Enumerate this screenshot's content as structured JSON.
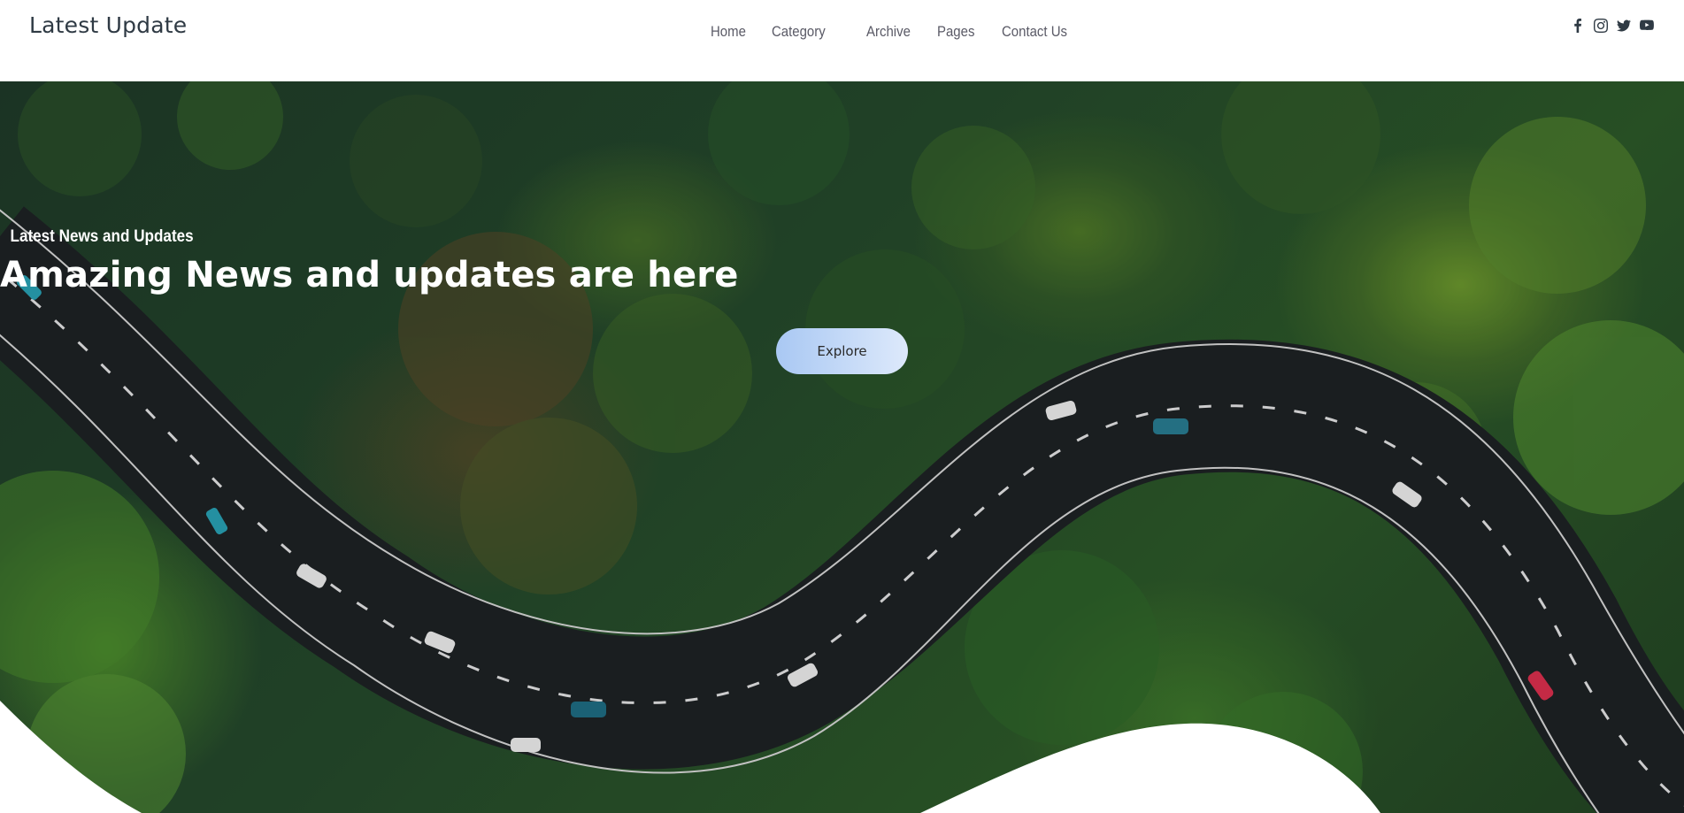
{
  "navbar": {
    "brand": "Latest Update",
    "links": [
      "Home",
      "Category",
      "Archive",
      "Pages",
      "Contact Us"
    ],
    "socials": [
      "facebook-icon",
      "instagram-icon",
      "twitter-icon",
      "youtube-icon"
    ]
  },
  "hero": {
    "eyebrow": "Latest News and Updates",
    "title": "Amazing News and updates are here",
    "button_label": "Explore",
    "background": "aerial view of winding road through forest"
  },
  "colors": {
    "brand_text": "#2f3a44",
    "nav_text": "#5a5a66",
    "button_gradient_start": "#a9c8f3",
    "button_gradient_end": "#dde9fb",
    "hero_text": "#ffffff"
  }
}
